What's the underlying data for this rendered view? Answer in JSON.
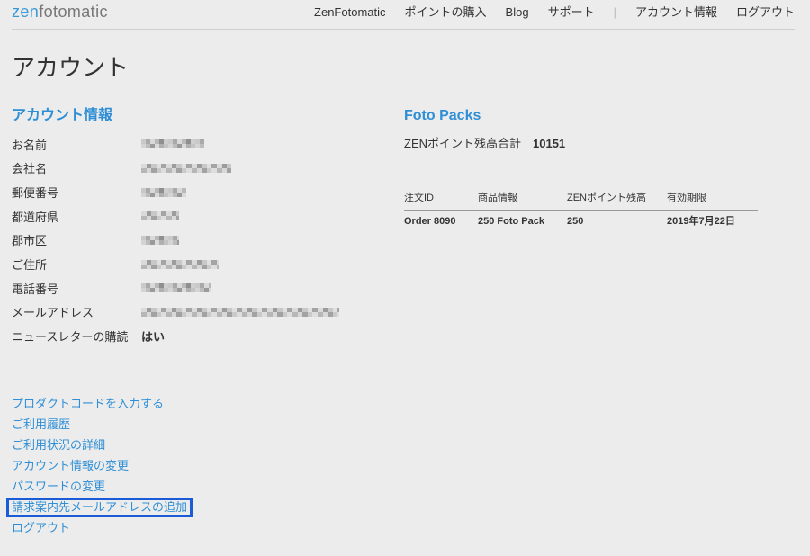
{
  "colors": {
    "accent": "#2f8fd6",
    "background": "#ececec",
    "text": "#333333",
    "highlight": "#1a5cd8",
    "logo_zen": "#3a9ad9",
    "logo_rest": "#777777"
  },
  "header": {
    "logo": {
      "zen": "zen",
      "rest": "fotomatic"
    },
    "nav": [
      {
        "label": "ZenFotomatic"
      },
      {
        "label": "ポイントの購入"
      },
      {
        "label": "Blog"
      },
      {
        "label": "サポート"
      },
      {
        "label": "|"
      },
      {
        "label": "アカウント情報"
      },
      {
        "label": "ログアウト"
      }
    ]
  },
  "page_title": "アカウント",
  "account": {
    "heading": "アカウント情報",
    "rows": [
      {
        "label": "お名前",
        "redacted": true
      },
      {
        "label": "会社名",
        "redacted": true
      },
      {
        "label": "郵便番号",
        "redacted": true
      },
      {
        "label": "都道府県",
        "redacted": true
      },
      {
        "label": "郡市区",
        "redacted": true
      },
      {
        "label": "ご住所",
        "redacted": true
      },
      {
        "label": "電話番号",
        "redacted": true
      },
      {
        "label": "メールアドレス",
        "redacted": true
      },
      {
        "label": "ニュースレターの購読",
        "value": "はい"
      }
    ]
  },
  "foto_packs": {
    "heading": "Foto Packs",
    "total_label": "ZENポイント残高合計",
    "total_value": "10151",
    "table": {
      "columns": [
        "注文ID",
        "商品情報",
        "ZENポイント残高",
        "有効期限"
      ],
      "rows": [
        [
          "Order 8090",
          "250 Foto Pack",
          "250",
          "2019年7月22日"
        ]
      ]
    }
  },
  "links": [
    {
      "label": "プロダクトコードを入力する"
    },
    {
      "label": "ご利用履歴"
    },
    {
      "label": "ご利用状況の詳細"
    },
    {
      "label": "アカウント情報の変更"
    },
    {
      "label": "パスワードの変更"
    },
    {
      "label": "請求案内先メールアドレスの追加",
      "highlighted": true
    },
    {
      "label": "ログアウト"
    }
  ]
}
